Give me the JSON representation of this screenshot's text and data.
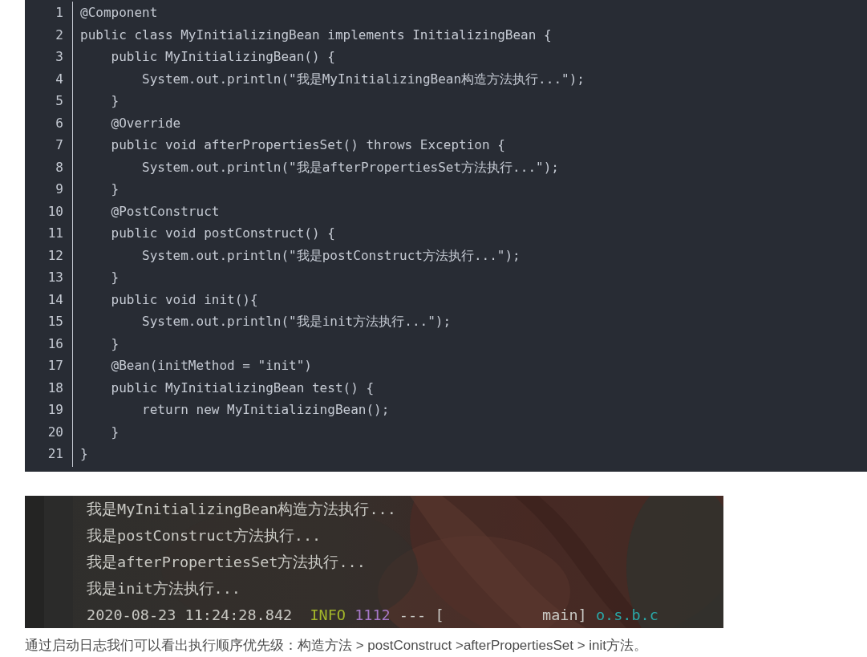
{
  "code_block": {
    "lines": [
      {
        "number": "1",
        "code": "@Component"
      },
      {
        "number": "2",
        "code": "public class MyInitializingBean implements InitializingBean {"
      },
      {
        "number": "3",
        "code": "    public MyInitializingBean() {"
      },
      {
        "number": "4",
        "code": "        System.out.println(\"我是MyInitializingBean构造方法执行...\");"
      },
      {
        "number": "5",
        "code": "    }"
      },
      {
        "number": "6",
        "code": "    @Override"
      },
      {
        "number": "7",
        "code": "    public void afterPropertiesSet() throws Exception {"
      },
      {
        "number": "8",
        "code": "        System.out.println(\"我是afterPropertiesSet方法执行...\");"
      },
      {
        "number": "9",
        "code": "    }"
      },
      {
        "number": "10",
        "code": "    @PostConstruct"
      },
      {
        "number": "11",
        "code": "    public void postConstruct() {"
      },
      {
        "number": "12",
        "code": "        System.out.println(\"我是postConstruct方法执行...\");"
      },
      {
        "number": "13",
        "code": "    }"
      },
      {
        "number": "14",
        "code": "    public void init(){"
      },
      {
        "number": "15",
        "code": "        System.out.println(\"我是init方法执行...\");"
      },
      {
        "number": "16",
        "code": "    }"
      },
      {
        "number": "17",
        "code": "    @Bean(initMethod = \"init\")"
      },
      {
        "number": "18",
        "code": "    public MyInitializingBean test() {"
      },
      {
        "number": "19",
        "code": "        return new MyInitializingBean();"
      },
      {
        "number": "20",
        "code": "    }"
      },
      {
        "number": "21",
        "code": "}"
      }
    ]
  },
  "console_screenshot": {
    "lines": [
      {
        "segments": [
          {
            "text": "我是MyInitializingBean构造方法执行...",
            "kind": "plain"
          }
        ]
      },
      {
        "segments": [
          {
            "text": "我是postConstruct方法执行...",
            "kind": "plain"
          }
        ]
      },
      {
        "segments": [
          {
            "text": "我是afterPropertiesSet方法执行...",
            "kind": "plain"
          }
        ]
      },
      {
        "segments": [
          {
            "text": "我是init方法执行...",
            "kind": "plain"
          }
        ]
      },
      {
        "segments": [
          {
            "text": "2020-08-23 11:24:28.842  ",
            "kind": "plain"
          },
          {
            "text": "INFO",
            "kind": "level"
          },
          {
            "text": "1112",
            "kind": "pid"
          },
          {
            "text": " --- [           main] ",
            "kind": "plain"
          },
          {
            "text": "o.s.b.c",
            "kind": "logger"
          }
        ]
      }
    ]
  },
  "caption": "通过启动日志我们可以看出执行顺序优先级：构造方法 > postConstruct >afterPropertiesSet > init方法。"
}
